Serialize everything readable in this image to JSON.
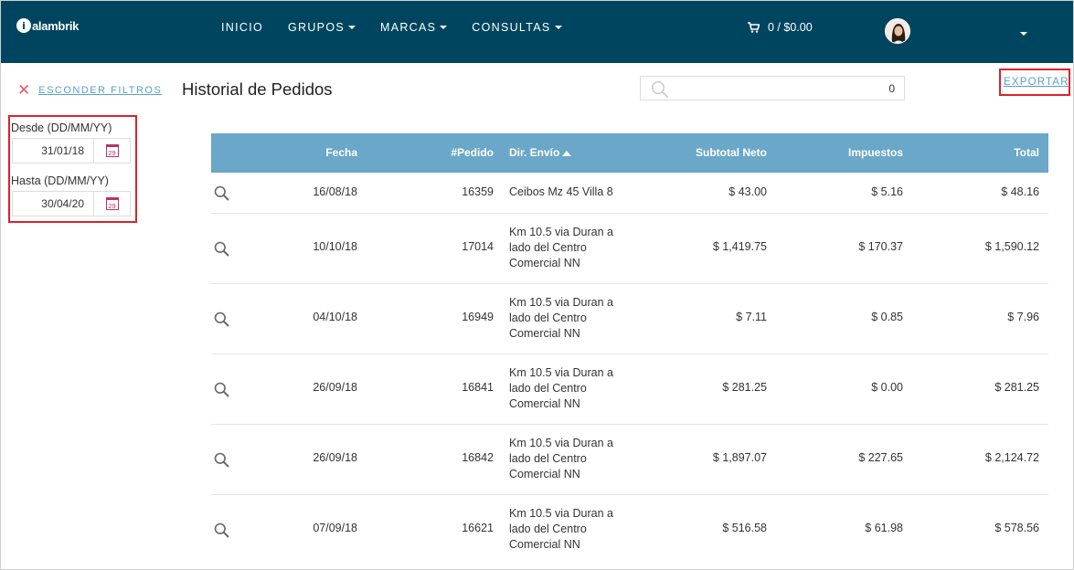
{
  "navbar": {
    "logo_text": "alambrik",
    "logo_mark": "i",
    "menu": [
      {
        "label": "INICIO",
        "dropdown": false
      },
      {
        "label": "GRUPOS",
        "dropdown": true
      },
      {
        "label": "MARCAS",
        "dropdown": true
      },
      {
        "label": "CONSULTAS",
        "dropdown": true
      }
    ],
    "cart_label": "0 / $0.00",
    "icons": {
      "cart": "cart-icon",
      "user": "avatar",
      "caret": "chevron-down-icon"
    }
  },
  "filters": {
    "hide_label": "ESCONDER FILTROS",
    "desde_label": "Desde (DD/MM/YY)",
    "desde_value": "31/01/18",
    "hasta_label": "Hasta (DD/MM/YY)",
    "hasta_value": "30/04/20",
    "calendar_day": "29"
  },
  "main": {
    "title": "Historial de Pedidos",
    "search_value": "0",
    "export_label": "EXPORTAR"
  },
  "table": {
    "headers": {
      "fecha": "Fecha",
      "pedido": "#Pedido",
      "dir": "Dir. Envío",
      "subtotal": "Subtotal Neto",
      "impuestos": "Impuestos",
      "total": "Total"
    },
    "rows": [
      {
        "fecha": "16/08/18",
        "pedido": "16359",
        "dir": "Ceibos Mz 45 Villa 8",
        "subtotal": "$ 43.00",
        "impuestos": "$ 5.16",
        "total": "$ 48.16"
      },
      {
        "fecha": "10/10/18",
        "pedido": "17014",
        "dir": "Km 10.5 via Duran a lado del Centro Comercial NN",
        "subtotal": "$ 1,419.75",
        "impuestos": "$ 170.37",
        "total": "$ 1,590.12"
      },
      {
        "fecha": "04/10/18",
        "pedido": "16949",
        "dir": "Km 10.5 via Duran a lado del Centro Comercial NN",
        "subtotal": "$ 7.11",
        "impuestos": "$ 0.85",
        "total": "$ 7.96"
      },
      {
        "fecha": "26/09/18",
        "pedido": "16841",
        "dir": "Km 10.5 via Duran a lado del Centro Comercial NN",
        "subtotal": "$ 281.25",
        "impuestos": "$ 0.00",
        "total": "$ 281.25"
      },
      {
        "fecha": "26/09/18",
        "pedido": "16842",
        "dir": "Km 10.5 via Duran a lado del Centro Comercial NN",
        "subtotal": "$ 1,897.07",
        "impuestos": "$ 227.65",
        "total": "$ 2,124.72"
      },
      {
        "fecha": "07/09/18",
        "pedido": "16621",
        "dir": "Km 10.5 via Duran a lado del Centro Comercial NN",
        "subtotal": "$ 516.58",
        "impuestos": "$ 61.98",
        "total": "$ 578.56"
      }
    ]
  },
  "colors": {
    "navbar": "#00455f",
    "table_header": "#6aa7c8",
    "link": "#5aa0c9",
    "highlight": "#d9232d",
    "close_x": "#e35b6a"
  }
}
